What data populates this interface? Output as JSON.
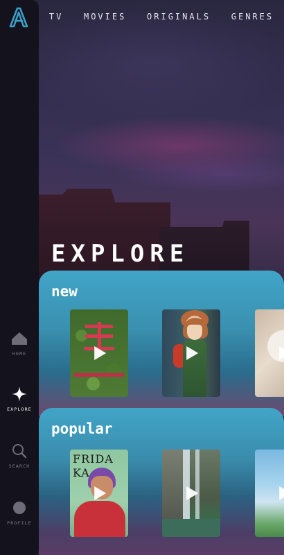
{
  "nav": {
    "items": [
      "TV",
      "MOVIES",
      "ORIGINALS",
      "GENRES"
    ]
  },
  "sidebar": {
    "logo_icon": "a-logo-icon",
    "items": [
      {
        "label": "HOME",
        "icon": "home-icon",
        "active": false
      },
      {
        "label": "EXPLORE",
        "icon": "star-sparkle-icon",
        "active": true
      },
      {
        "label": "SEARCH",
        "icon": "search-icon",
        "active": false
      },
      {
        "label": "PROFILE",
        "icon": "profile-icon",
        "active": false
      }
    ]
  },
  "page": {
    "title": "EXPLORE"
  },
  "shelves": [
    {
      "title": "new",
      "cards": [
        "garden-sign-thumbnail",
        "anime-girl-thumbnail",
        "dog-thumbnail"
      ]
    },
    {
      "title": "popular",
      "cards": [
        "frida-poster-thumbnail",
        "waterfall-thumbnail",
        "sky-thumbnail"
      ]
    }
  ],
  "cards_text": {
    "frida_line1": "FRIDA",
    "frida_line2": "KA"
  },
  "colors": {
    "shelf_accent": "#41a5c8",
    "sidebar_bg": "#14121c",
    "logo_accent": "#3aa0c8"
  }
}
